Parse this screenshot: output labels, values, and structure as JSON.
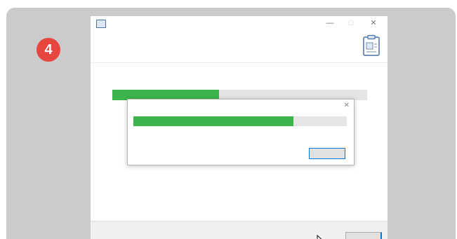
{
  "step": {
    "number": "4"
  },
  "installer": {
    "window_title": "",
    "header_heading": "",
    "header_subtitle": "",
    "status_text": "",
    "main_progress": 0.42,
    "footer_button": ""
  },
  "dialog": {
    "title": "",
    "progress": 0.75,
    "status_text": "",
    "cancel_label": ""
  },
  "icons": {
    "app": "installer-app-icon",
    "header": "clipboard-icon",
    "cursor": "mouse-cursor-icon",
    "window_controls": [
      "minimize-icon",
      "maximize-icon",
      "close-icon"
    ]
  },
  "colors": {
    "badge": "#e6463e",
    "progress": "#3cb44b",
    "focus": "#0078d7",
    "background_panel": "#cbcbcb"
  }
}
